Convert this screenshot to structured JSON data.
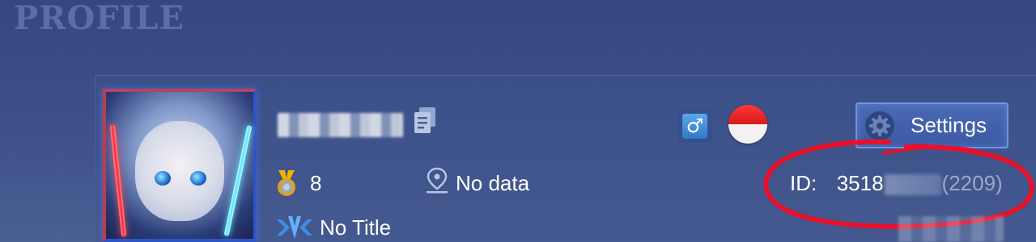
{
  "header": {
    "title": "PROFILE"
  },
  "profile": {
    "gender_symbol": "♂",
    "settings_label": "Settings",
    "rank_value": "8",
    "location_value": "No data",
    "title_value": "No Title",
    "id_label": "ID:",
    "id_visible_prefix": "3518",
    "id_server": "(2209)"
  },
  "icons": {
    "copy": "copy-icon",
    "gender": "male-icon",
    "flag": "indonesia-flag-icon",
    "settings": "gear-icon",
    "rank": "medal-icon",
    "location": "location-pin-icon",
    "title": "title-emblem-icon"
  },
  "colors": {
    "background": "#3e5189",
    "panel": "#44598f",
    "button_border": "#6f93e4",
    "annotation": "#e8102a",
    "muted_text": "#9aa9c9"
  }
}
